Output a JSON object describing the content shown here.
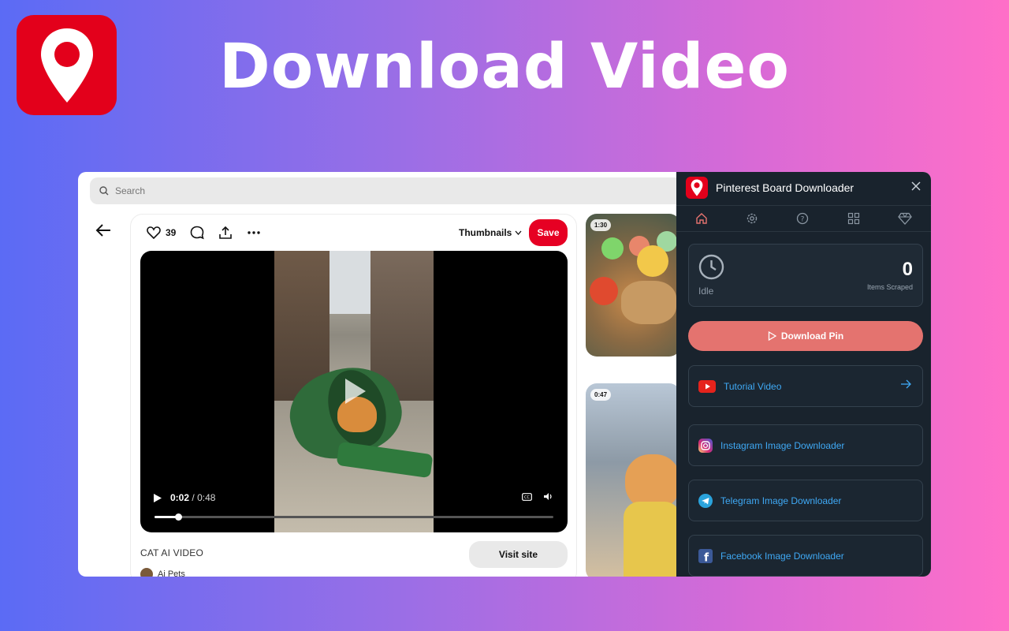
{
  "hero": {
    "title": "Download Video"
  },
  "search": {
    "placeholder": "Search"
  },
  "pin": {
    "like_count": "39",
    "thumbnails_label": "Thumbnails",
    "save_label": "Save",
    "current_time": "0:02",
    "separator": "/",
    "duration": "0:48",
    "progress_fraction": 0.06,
    "title": "CAT AI VIDEO",
    "visit_label": "Visit site",
    "creator": "Ai Pets"
  },
  "side_pins": [
    {
      "badge": "1:30"
    },
    {
      "badge": "0:47"
    }
  ],
  "extension": {
    "title": "Pinterest Board Downloader",
    "nav": [
      "home-icon",
      "settings-icon",
      "help-icon",
      "grid-icon",
      "diamond-icon"
    ],
    "status": {
      "state": "Idle",
      "count": "0",
      "count_label": "Items Scraped"
    },
    "download_label": "Download Pin",
    "links": [
      {
        "label": "Tutorial Video",
        "icon": "youtube-icon"
      },
      {
        "label": "Instagram Image Downloader",
        "icon": "instagram-icon"
      },
      {
        "label": "Telegram Image Downloader",
        "icon": "telegram-icon"
      },
      {
        "label": "Facebook Image Downloader",
        "icon": "facebook-icon"
      }
    ]
  },
  "colors": {
    "brand_red": "#e3001b",
    "pinterest_save": "#e60023",
    "panel_bg": "#19232d",
    "download_button": "#e4736f",
    "link_text": "#3fa9f5"
  }
}
